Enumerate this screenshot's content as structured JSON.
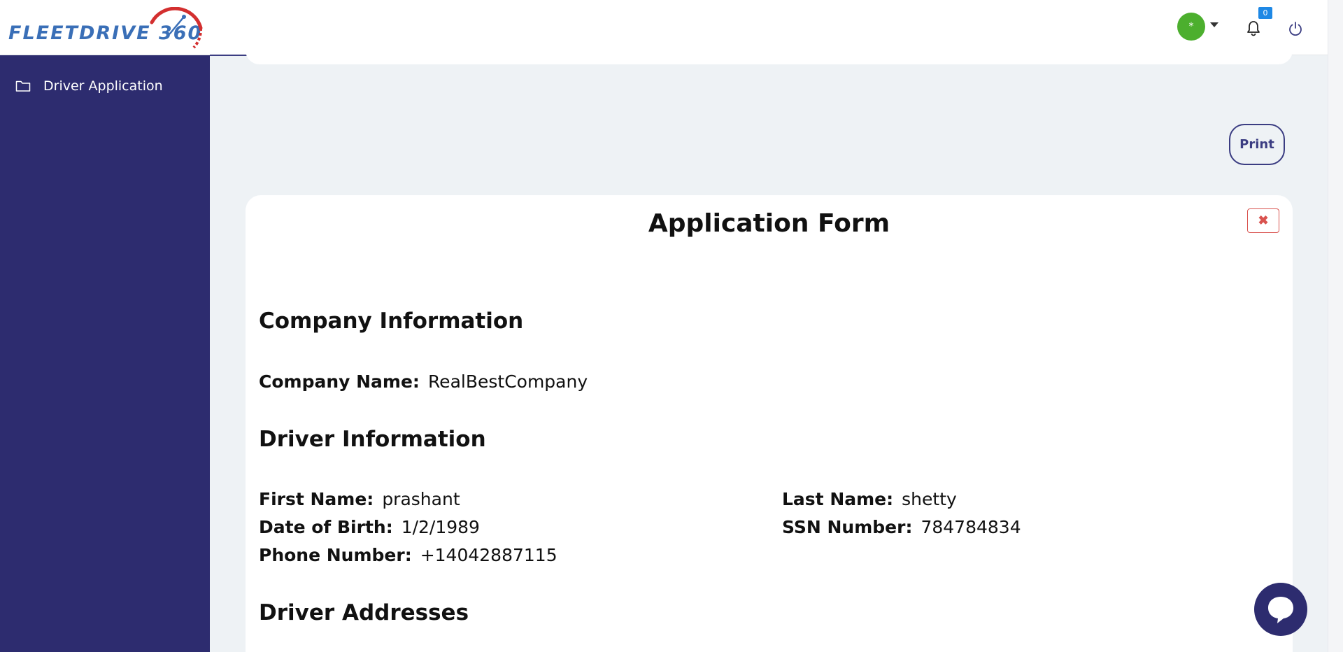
{
  "brand": {
    "logo_text": "FLEETDRIVE 360"
  },
  "header": {
    "avatar_initial": "*",
    "notification_count": "0"
  },
  "sidebar": {
    "items": [
      {
        "label": "Driver Application",
        "icon": "folder-icon"
      }
    ]
  },
  "toolbar": {
    "print_label": "Print"
  },
  "form": {
    "title": "Application Form",
    "close_label": "✖",
    "sections": {
      "company": {
        "title": "Company Information",
        "company_name_label": "Company Name:",
        "company_name_value": "RealBestCompany"
      },
      "driver": {
        "title": "Driver Information",
        "first_name_label": "First Name:",
        "first_name_value": "prashant",
        "last_name_label": "Last Name:",
        "last_name_value": "shetty",
        "dob_label": "Date of Birth:",
        "dob_value": "1/2/1989",
        "ssn_label": "SSN Number:",
        "ssn_value": "784784834",
        "phone_label": "Phone Number:",
        "phone_value": "+14042887115"
      },
      "addresses": {
        "title": "Driver Addresses"
      }
    }
  },
  "colors": {
    "sidebar_bg": "#2d2c6f",
    "accent": "#3b3d82",
    "avatar_bg": "#4caf2e",
    "badge_bg": "#1e88e5",
    "danger": "#d9534f",
    "logo_blue": "#3a6fb7",
    "logo_red": "#d32f2f"
  }
}
